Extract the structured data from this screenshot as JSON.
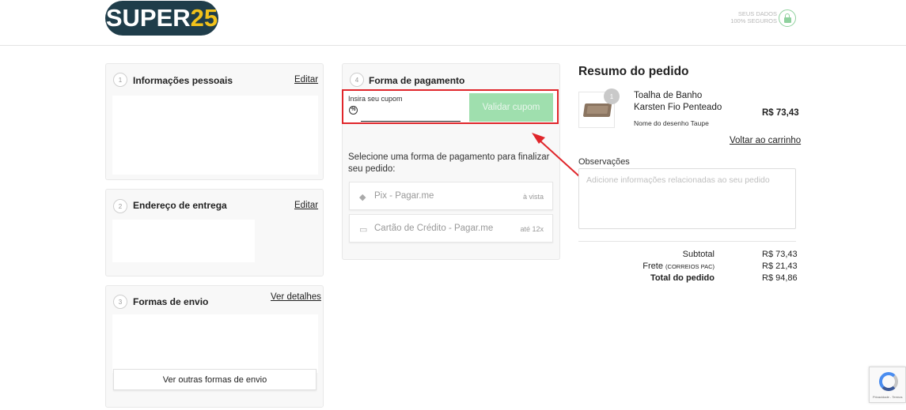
{
  "header": {
    "logo_white": "SUPER",
    "logo_yellow": "25",
    "secure_line1": "SEUS DADOS",
    "secure_line2": "100% SEGUROS",
    "lock_icon": "lock-icon"
  },
  "personal": {
    "step": "1",
    "title": "Informações pessoais",
    "edit": "Editar"
  },
  "address": {
    "step": "2",
    "title": "Endereço de entrega",
    "edit": "Editar"
  },
  "shipping": {
    "step": "3",
    "title": "Formas de envio",
    "details": "Ver detalhes",
    "other_button": "Ver outras formas de envio"
  },
  "payment": {
    "step": "4",
    "title": "Forma de pagamento",
    "coupon_label": "Insira seu cupom",
    "coupon_value": "",
    "coupon_button": "Validar cupom",
    "instruction": "Selecione uma forma de pagamento para finalizar seu pedido:",
    "options": [
      {
        "name": "Pix - Pagar.me",
        "meta": "à vista",
        "icon": "pix-icon"
      },
      {
        "name": "Cartão de Crédito - Pagar.me",
        "meta": "até 12x",
        "icon": "credit-card-icon"
      }
    ]
  },
  "summary": {
    "title": "Resumo do pedido",
    "product": {
      "qty": "1",
      "name": "Toalha de Banho Karsten Fio Penteado",
      "variant": "Nome do desenho Taupe",
      "price": "R$ 73,43"
    },
    "back_to_cart": "Voltar ao carrinho",
    "observations_label": "Observações",
    "observations_placeholder": "Adicione informações relacionadas ao seu pedido",
    "subtotal_label": "Subtotal",
    "subtotal_value": "R$ 73,43",
    "freight_label": "Frete",
    "freight_method": "(CORREIOS PAC)",
    "freight_value": "R$ 21,43",
    "total_label": "Total do pedido",
    "total_value": "R$ 94,86"
  },
  "recaptcha": {
    "text": "Privacidade - Termos"
  },
  "colors": {
    "brand_dark": "#1f3d4a",
    "brand_yellow": "#f2c21a",
    "validate_button": "#9fdfae",
    "highlight_red": "#e0262b",
    "secure_green": "#8fd19e"
  }
}
